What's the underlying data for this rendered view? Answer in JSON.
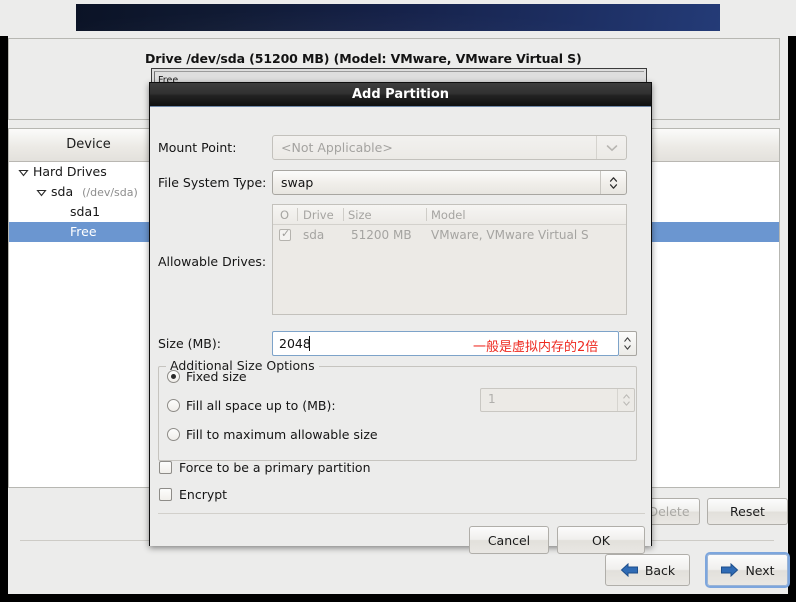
{
  "banner": {
    "name": "installer-banner"
  },
  "main": {
    "drive_title": "Drive /dev/sda (51200 MB) (Model: VMware, VMware Virtual S)",
    "drive_bar_label": "Free",
    "table_header": "Device",
    "rows": [
      {
        "label": "Hard Drives",
        "detail": "",
        "indent": 0,
        "expander": true,
        "selected": false
      },
      {
        "label": "sda",
        "detail": "(/dev/sda)",
        "indent": 1,
        "expander": true,
        "selected": false
      },
      {
        "label": "sda1",
        "detail": "",
        "indent": 2,
        "expander": false,
        "selected": false
      },
      {
        "label": "Free",
        "detail": "",
        "indent": 2,
        "expander": false,
        "selected": true
      }
    ],
    "buttons": {
      "delete": "Delete",
      "reset": "Reset",
      "back": "Back",
      "next": "Next"
    }
  },
  "dialog": {
    "title": "Add Partition",
    "mount_point": {
      "label": "Mount Point:",
      "value": "<Not Applicable>"
    },
    "file_system_type": {
      "label": "File System Type:",
      "value": "swap"
    },
    "allowable_drives": {
      "label": "Allowable Drives:",
      "columns": [
        "O",
        "Drive",
        "Size",
        "Model"
      ],
      "rows": [
        {
          "checked": true,
          "drive": "sda",
          "size": "51200 MB",
          "model": "VMware, VMware Virtual S"
        }
      ]
    },
    "size": {
      "label": "Size (MB):",
      "value": "2048",
      "annotation": "一般是虚拟内存的2倍"
    },
    "additional_size_options": {
      "legend": "Additional Size Options",
      "options": [
        {
          "label": "Fixed size",
          "selected": true
        },
        {
          "label": "Fill all space up to (MB):",
          "selected": false
        },
        {
          "label": "Fill to maximum allowable size",
          "selected": false
        }
      ],
      "fill_value": "1"
    },
    "checkboxes": [
      {
        "label": "Force to be a primary partition",
        "checked": false
      },
      {
        "label": "Encrypt",
        "checked": false
      }
    ],
    "buttons": {
      "cancel": "Cancel",
      "ok": "OK"
    }
  },
  "colors": {
    "selection_blue": "#6b96d0",
    "annotation_red": "#ee2a20",
    "banner_dark": "#0b1326",
    "banner_light": "#243b77",
    "window_bg": "#ececeb"
  }
}
